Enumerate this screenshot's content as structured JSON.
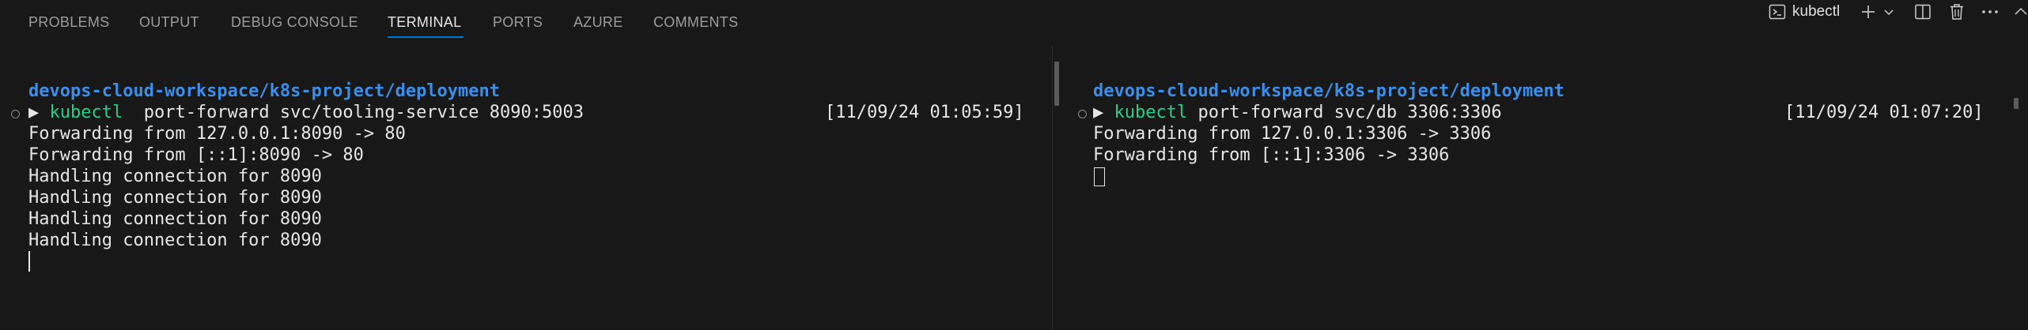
{
  "tabs": [
    {
      "label": "PROBLEMS",
      "active": false
    },
    {
      "label": "OUTPUT",
      "active": false
    },
    {
      "label": "DEBUG CONSOLE",
      "active": false
    },
    {
      "label": "TERMINAL",
      "active": true
    },
    {
      "label": "PORTS",
      "active": false
    },
    {
      "label": "AZURE",
      "active": false
    },
    {
      "label": "COMMENTS",
      "active": false
    }
  ],
  "actions": {
    "terminal_name": "kubectl",
    "icons": [
      "terminal-icon",
      "plus-icon",
      "chevron-down-icon",
      "split-editor-icon",
      "trash-icon",
      "more-icon",
      "maximize-icon"
    ]
  },
  "left_pane": {
    "cwd": "devops-cloud-workspace/k8s-project/deployment",
    "prompt": "▶",
    "command_name": "kubectl",
    "command_args": "  port-forward svc/tooling-service 8090:5003",
    "timestamp": "[11/09/24 01:05:59]",
    "output": [
      "Forwarding from 127.0.0.1:8090 -> 80",
      "Forwarding from [::1]:8090 -> 80",
      "Handling connection for 8090",
      "Handling connection for 8090",
      "Handling connection for 8090",
      "Handling connection for 8090"
    ]
  },
  "right_pane": {
    "cwd": "devops-cloud-workspace/k8s-project/deployment",
    "prompt": "▶",
    "command_name": "kubectl",
    "command_args": " port-forward svc/db 3306:3306",
    "timestamp": "[11/09/24 01:07:20]",
    "output": [
      "Forwarding from 127.0.0.1:3306 -> 3306",
      "Forwarding from [::1]:3306 -> 3306"
    ]
  },
  "colors": {
    "background": "#181818",
    "accent": "#0078d4",
    "cwd": "#3b8eea",
    "command": "#23d18b",
    "text": "#e6e6e6"
  }
}
